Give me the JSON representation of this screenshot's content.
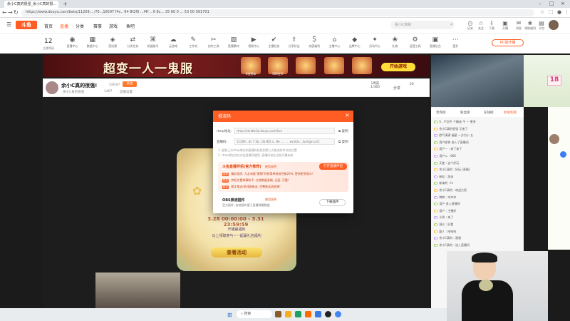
{
  "browser": {
    "tab_title": "余小C真的很强_余小C真的很...",
    "url": "https://www.douyu.com/beta/11209... /?0...16597 f4c.. 64 8f2f0 ...f4f .. 6 8c... 35 60 0 ... 53 00 091701"
  },
  "site": {
    "logo": "斗鱼",
    "nav": [
      "首页",
      "直播",
      "分类",
      "赛事",
      "游戏",
      "鱼吧"
    ],
    "search_placeholder": "余小C真的",
    "header_icons": [
      {
        "icon": "clock-icon",
        "label": "历史"
      },
      {
        "icon": "star-icon",
        "label": "关注"
      },
      {
        "icon": "download-icon",
        "label": "下载"
      },
      {
        "icon": "open-icon",
        "label": "开播"
      },
      {
        "icon": "chat-icon",
        "label": "消息"
      },
      {
        "icon": "gift-icon",
        "label": "领取福利"
      },
      {
        "icon": "card-icon",
        "label": "卡包"
      }
    ]
  },
  "toolrow": {
    "level": "12",
    "level_label": "主播等级",
    "items": [
      "直播中心",
      "数据中心",
      "竞技赛",
      "分发任务",
      "机器账号",
      "云游戏",
      "工作坊",
      "创作工具",
      "直播素材",
      "视频中心",
      "主播任务",
      "分享好友",
      "充值福利",
      "主播中心",
      "品牌中心",
      "活动中心",
      "礼物",
      "运营工具",
      "直播后台",
      "更多"
    ],
    "pc_button": "PC端开播"
  },
  "banner": {
    "title": "超变一人一鬼服",
    "gifts": [
      "2倍资本",
      "500金币",
      "",
      "",
      ""
    ],
    "start_button": "开始游戏"
  },
  "room": {
    "name": "余小C真的很强!",
    "id": "549187",
    "follow": "关注",
    "sub": [
      "余小C真的很强",
      "1467",
      "直播设置"
    ],
    "rank": "1周前",
    "rank2": "1/360",
    "share": "分享",
    "gold": "20"
  },
  "modal": {
    "title": "推流码",
    "rtmp_label": "rtmp地址:",
    "rtmp_value": "rtmp://sendtc3a.douyu.com/live",
    "key_label": "直播码:",
    "key_value": "11209...4c 7 2b...0b 8f2 a...9e  ..... ... wcsId=...&origin=tct",
    "copy": "复制",
    "notes": [
      "1. 复制上方rtmp地址和直播码粘贴到第三方推流软件对应位置",
      "2. rtmp地址仅在对此直播间使用, 直播码仅在当前开播有效"
    ],
    "promo_title": "斗鱼直播伴侣(官方推荐)",
    "promo_link": "使用说明",
    "promo_button": "打开直播伴侣",
    "promo_lines": [
      "高效 精彩画质, 大友海量\"票圈\"特权简单装成性能20%, 更快更多观众!",
      "特效 特权先置弹幕助手, 礼物数据准确, 全面, 可靠!",
      "稳定 稳定推流/多线路推送, 完整推送流效果!"
    ],
    "obs_title": "OBS推流插件",
    "obs_link": "使用说明",
    "obs_desc": "官方插件, 安装插件便于直播弹幕数据",
    "obs_button": "下载插件"
  },
  "poster": {
    "date": "3.28 00:00:00 - 3.31 23:59:59",
    "text1": "开播赢福利",
    "text2": "马上领取参与~一起赢礼包福利",
    "button": "查看活动"
  },
  "chat": {
    "tabs": [
      "贵宾榜",
      "粉丝榜",
      "在线榜",
      "新福利榜"
    ],
    "rows": [
      "5.. 产回今 个精选 今 一 更多",
      "余小C真的很强 又来了",
      "欧气满满 福星 一方为小 五 ",
      "用户昵称 进入了直播间",
      "用户一 : 来了来了",
      "用户二 : 666",
      "天使 : 这个好玩",
      "余小C真的 : 好玩 [表情]",
      "粉丝 : 加油",
      "新来的 : hi",
      "余小C真的 : 欢迎大家",
      "鸭鸭 : 冲冲冲",
      "用户 进入直播间",
      "用户 : 主播好",
      "小明 : 来了",
      "观众 : 好看",
      "路人 : 哈哈哈",
      "余小C真的 : 谢谢",
      "余小C真的 : 进入直播间"
    ],
    "side_number": "18"
  },
  "taskbar": {
    "search": "搜索"
  },
  "colors": {
    "accent": "#ff5d23",
    "chat_badge": "#8bc34a"
  }
}
